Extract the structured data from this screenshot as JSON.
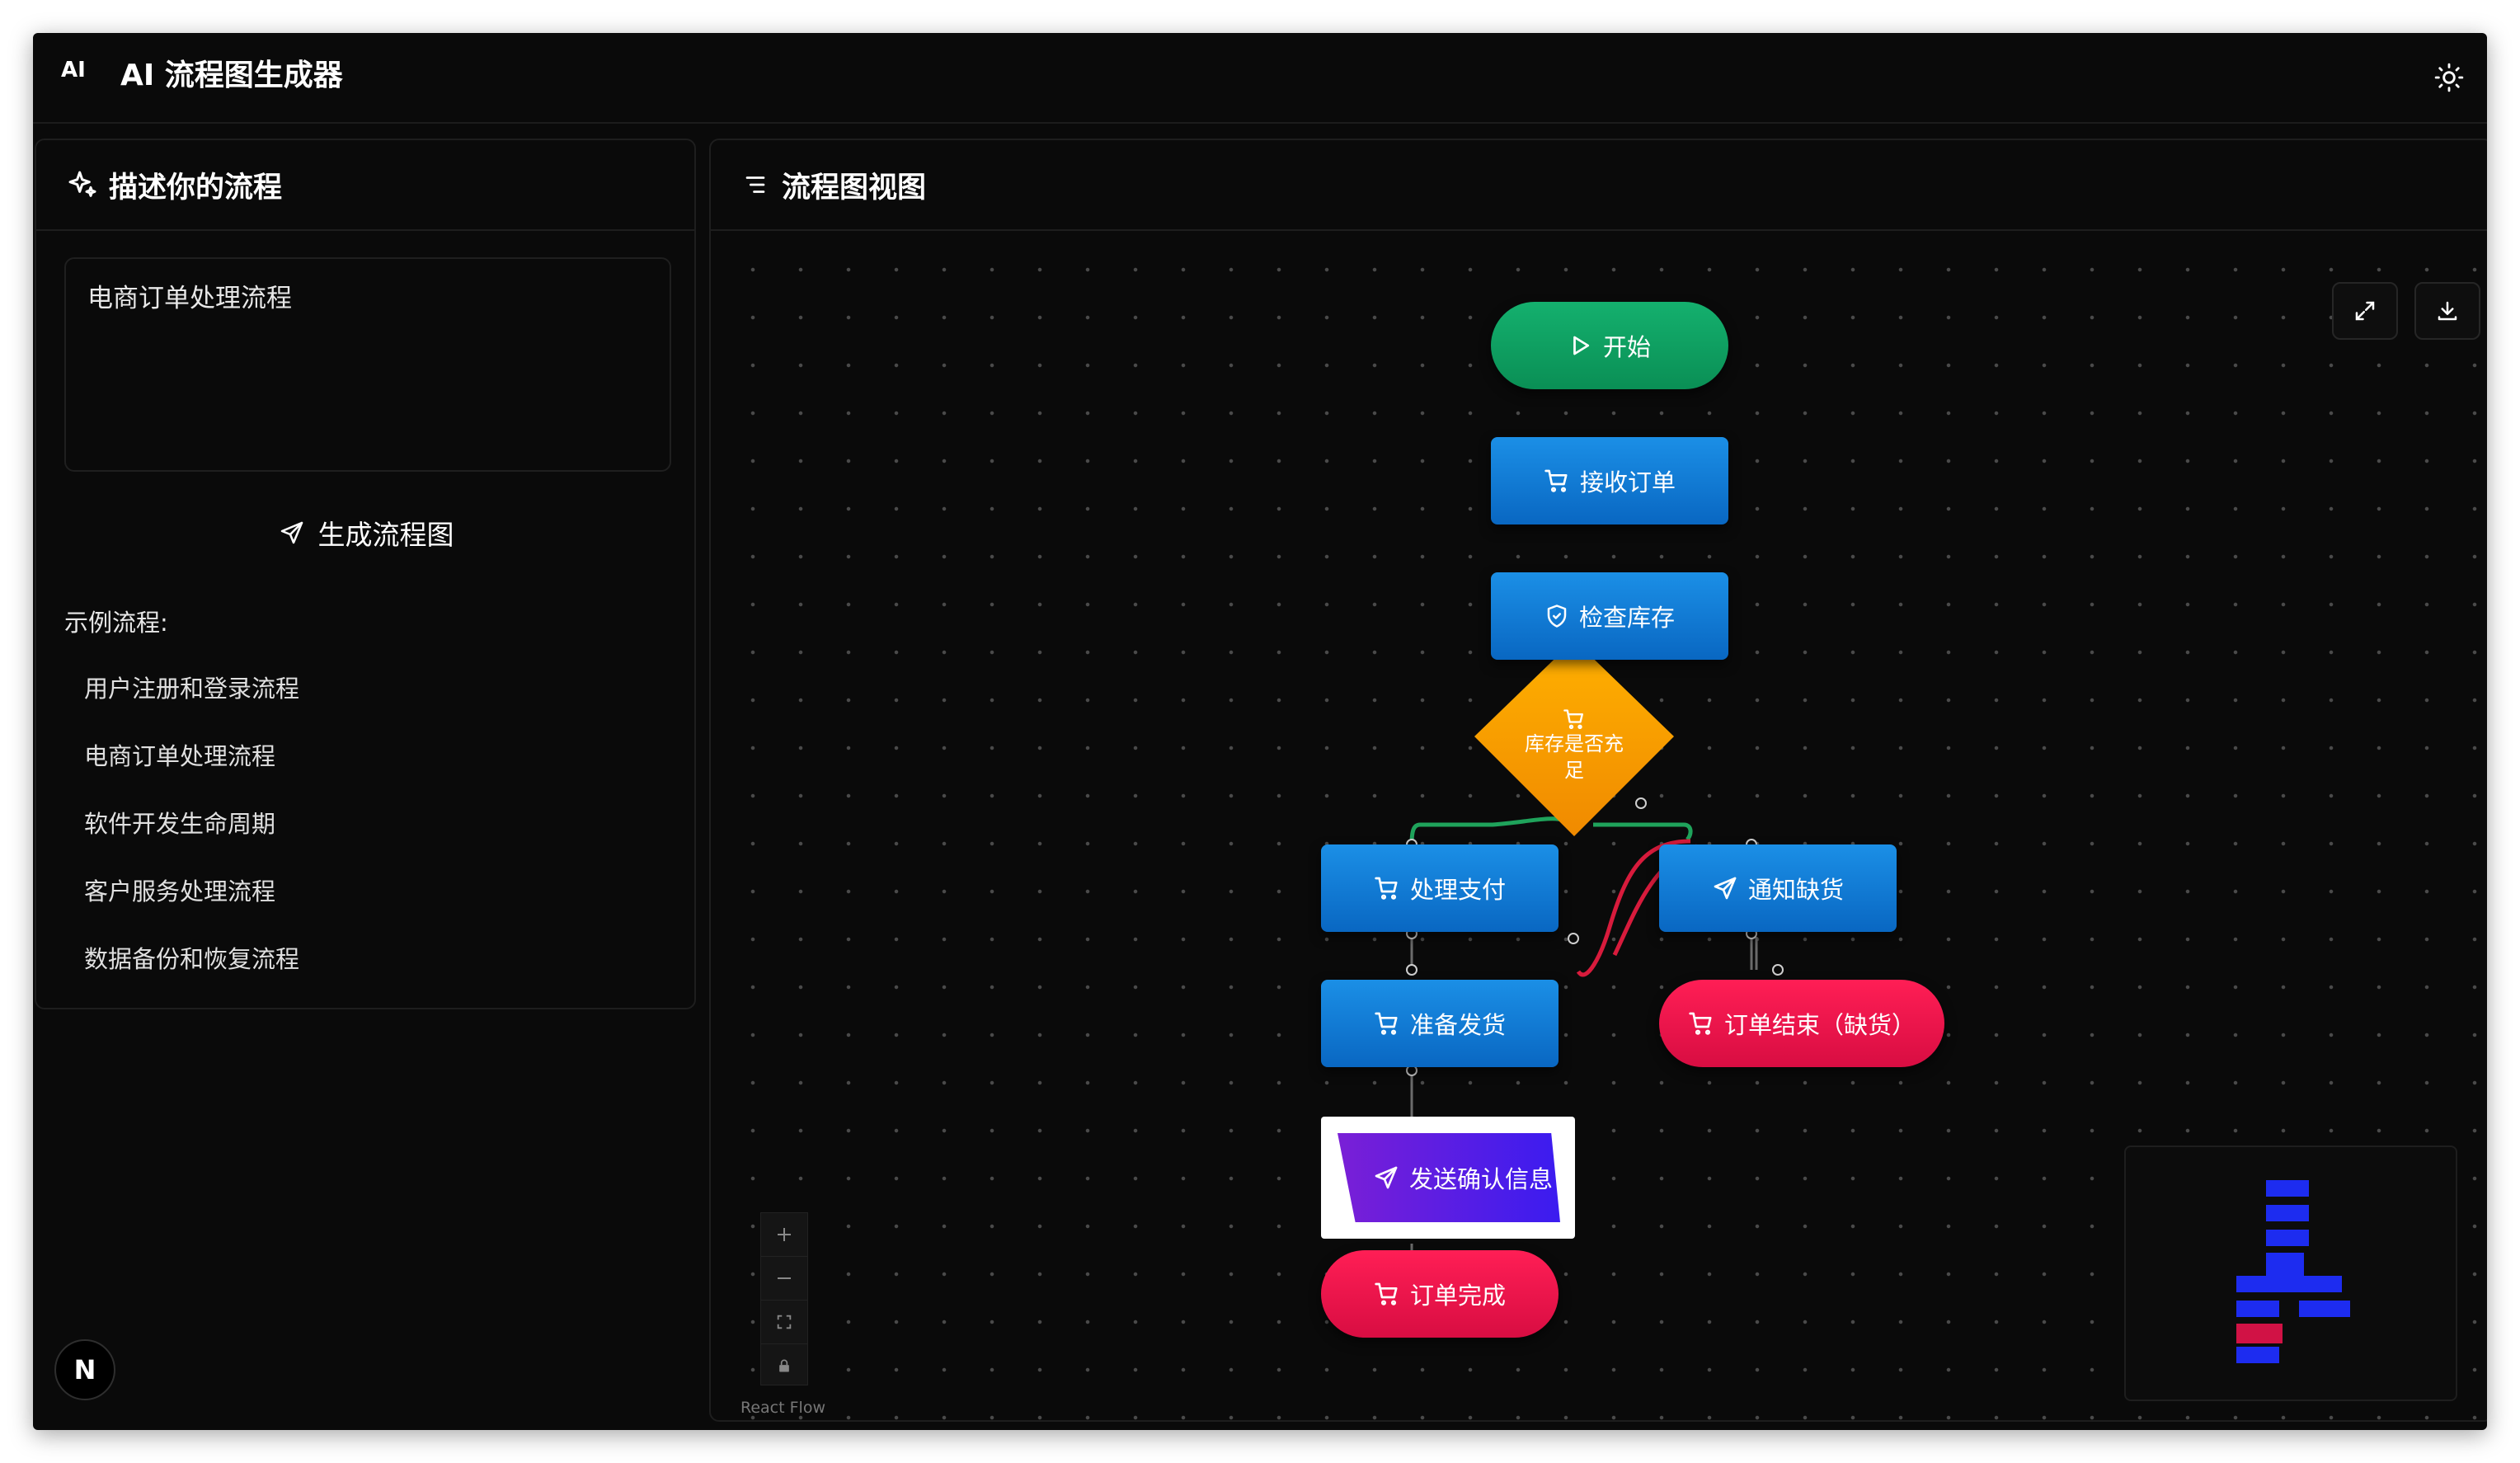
{
  "app": {
    "logo": "AI",
    "title": "AI 流程图生成器"
  },
  "left_panel": {
    "title": "描述你的流程",
    "description_value": "电商订单处理流程",
    "generate_button": "生成流程图",
    "examples_title": "示例流程:",
    "examples": [
      "用户注册和登录流程",
      "电商订单处理流程",
      "软件开发生命周期",
      "客户服务处理流程",
      "数据备份和恢复流程"
    ]
  },
  "right_panel": {
    "title": "流程图视图",
    "attribution": "React Flow"
  },
  "flow": {
    "nodes": [
      {
        "id": "start",
        "label": "开始",
        "type": "start",
        "icon": "play-icon"
      },
      {
        "id": "receive",
        "label": "接收订单",
        "type": "process",
        "icon": "cart-icon"
      },
      {
        "id": "check",
        "label": "检查库存",
        "type": "process",
        "icon": "shield-icon"
      },
      {
        "id": "decision",
        "label_line1": "库存是否充",
        "label_line2": "足",
        "type": "decision",
        "icon": "cart-icon"
      },
      {
        "id": "pay",
        "label": "处理支付",
        "type": "process",
        "icon": "cart-icon"
      },
      {
        "id": "notify",
        "label": "通知缺货",
        "type": "process",
        "icon": "send-icon"
      },
      {
        "id": "ship",
        "label": "准备发货",
        "type": "process",
        "icon": "cart-icon"
      },
      {
        "id": "end_out",
        "label": "订单结束（缺货）",
        "type": "end",
        "icon": "cart-icon"
      },
      {
        "id": "confirm",
        "label": "发送确认信息",
        "type": "io",
        "icon": "send-icon"
      },
      {
        "id": "done",
        "label": "订单完成",
        "type": "end",
        "icon": "cart-icon"
      }
    ]
  },
  "colors": {
    "background": "#0a0a0a",
    "process": "#0b74d6",
    "start": "#0fa463",
    "end": "#f0124a",
    "decision": "#ffa500",
    "io": "#5a1ee6",
    "edge_yes": "#1fa35b",
    "edge_no": "#d81b3c",
    "minimap_node": "#1d2cf0",
    "minimap_end": "#d11245"
  }
}
